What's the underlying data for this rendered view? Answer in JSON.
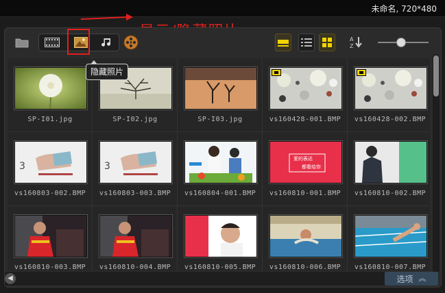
{
  "header": {
    "project_title": "未命名, 720*480"
  },
  "annotation": {
    "text": "显示/隐藏照片"
  },
  "tooltip": {
    "text": "隐藏照片"
  },
  "toolbar": {
    "icons": [
      "folder-icon",
      "video-filter-icon",
      "photo-filter-icon",
      "audio-filter-icon",
      "film-reel-icon",
      "large-thumbnail-view-icon",
      "list-view-icon",
      "grid-view-icon",
      "sort-az-icon",
      "zoom-slider"
    ]
  },
  "library": {
    "rows": [
      [
        {
          "name": "SP-I01.jpg",
          "thumb": "dandelion",
          "video": false
        },
        {
          "name": "SP-I02.jpg",
          "thumb": "tree",
          "video": false
        },
        {
          "name": "SP-I03.jpg",
          "thumb": "desert",
          "video": false
        },
        {
          "name": "vs160428-001.BMP",
          "thumb": "bokeh",
          "video": true
        },
        {
          "name": "vs160428-002.BMP",
          "thumb": "bokeh",
          "video": true
        }
      ],
      [
        {
          "name": "vs160803-002.BMP",
          "thumb": "hand-card",
          "video": false
        },
        {
          "name": "vs160803-003.BMP",
          "thumb": "hand-card",
          "video": false
        },
        {
          "name": "vs160804-001.BMP",
          "thumb": "couple",
          "video": false
        },
        {
          "name": "vs160810-001.BMP",
          "thumb": "red-card",
          "video": false
        },
        {
          "name": "vs160810-002.BMP",
          "thumb": "suit",
          "video": false
        }
      ],
      [
        {
          "name": "vs160810-003.BMP",
          "thumb": "athlete",
          "video": false
        },
        {
          "name": "vs160810-004.BMP",
          "thumb": "athlete",
          "video": false
        },
        {
          "name": "vs160810-005.BMP",
          "thumb": "red-portrait",
          "video": false
        },
        {
          "name": "vs160810-006.BMP",
          "thumb": "swimmer",
          "video": false
        },
        {
          "name": "vs160810-007.BMP",
          "thumb": "pool",
          "video": false
        }
      ]
    ],
    "red_card_text": [
      "爱的表达",
      "都看给你"
    ]
  },
  "footer": {
    "options_label": "选项",
    "options_icon": "double-chevron-up-icon",
    "scroll_left_icon": "chevron-left-icon"
  },
  "colors": {
    "annotation_red": "#e0201c",
    "accent_yellow": "#f2d400",
    "options_bg": "#35485a"
  }
}
